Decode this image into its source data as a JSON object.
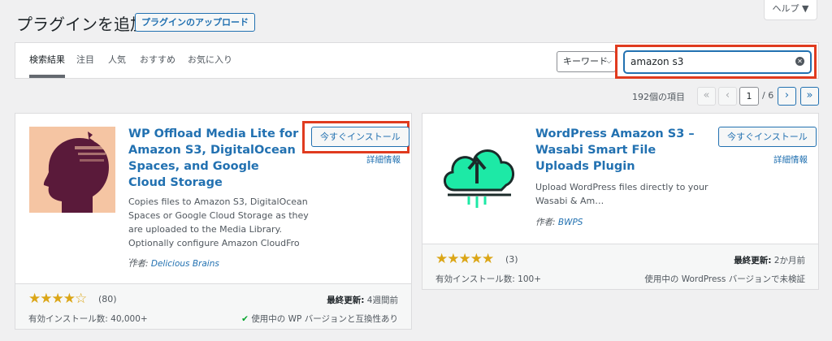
{
  "header": {
    "title": "プラグインを追加",
    "upload_label": "プラグインのアップロード",
    "help_label": "ヘルプ ▼"
  },
  "tabs": [
    {
      "label": "検索結果",
      "current": true
    },
    {
      "label": "注目"
    },
    {
      "label": "人気"
    },
    {
      "label": "おすすめ"
    },
    {
      "label": "お気に入り"
    }
  ],
  "search": {
    "type_label": "キーワード",
    "value": "amazon s3"
  },
  "pagination": {
    "count_label": "192個の項目",
    "current_page": "1",
    "total_label": "/ 6"
  },
  "plugins": [
    {
      "name": "WP Offload Media Lite for Amazon S3, DigitalOcean Spaces, and Google Cloud Storage",
      "install_label": "今すぐインストール",
      "details_label": "詳細情報",
      "description": "Copies files to Amazon S3, DigitalOcean Spaces or Google Cloud Storage as they are uploaded to the Media Library. Optionally configure Amazon CloudFro …",
      "author_prefix": "作者: ",
      "author": "Delicious Brains",
      "rating": 4,
      "rating_count": "(80)",
      "updated_label": "最終更新:",
      "updated_value": " 4週間前",
      "installs": "有効インストール数: 40,000+",
      "compat": "使用中の WP バージョンと互換性あり"
    },
    {
      "name": "WordPress Amazon S3 – Wasabi Smart File Uploads Plugin",
      "install_label": "今すぐインストール",
      "details_label": "詳細情報",
      "description": "Upload WordPress files directly to your Wasabi & Am…",
      "author_prefix": "作者: ",
      "author": "BWPS",
      "rating": 5,
      "rating_count": "(3)",
      "updated_label": "最終更新:",
      "updated_value": " 2か月前",
      "installs": "有効インストール数: 100+",
      "compat": "使用中の WordPress バージョンで未検証"
    }
  ],
  "colors": {
    "accent": "#2271b1",
    "highlight": "#e03b1f",
    "star": "#dba617",
    "icon1_bg": "#f5c5a3",
    "icon1_head": "#5a1a3a",
    "icon2_cloud": "#1de9a6",
    "icon2_dark": "#1b2b2a"
  }
}
